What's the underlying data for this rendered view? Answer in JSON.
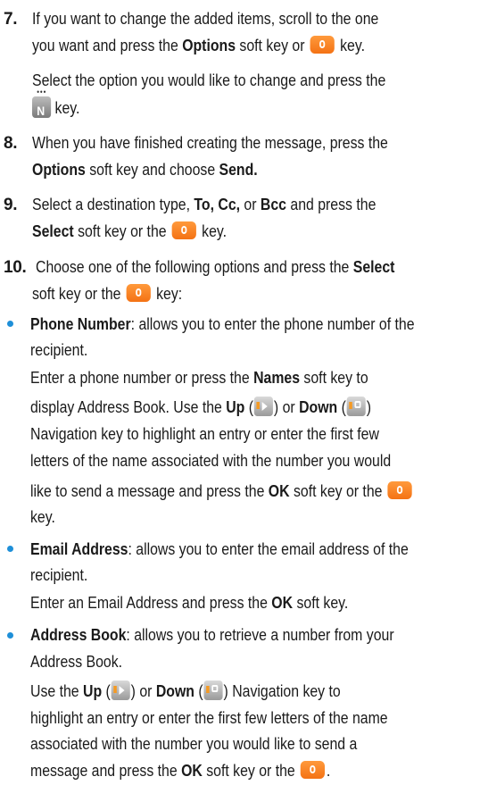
{
  "steps": {
    "s7": {
      "num": "7.",
      "l1": "If you want to change the added items, scroll to the one",
      "l2a": "you want and press the ",
      "l2b": "Options",
      "l2c": " soft key or ",
      "l2d": " key.",
      "l3": "Select the option you would like to change and press the",
      "l4": " key."
    },
    "s8": {
      "num": "8.",
      "l1": "When you have finished creating the message, press the",
      "l2a": "Options",
      "l2b": " soft key and choose ",
      "l2c": "Send."
    },
    "s9": {
      "num": "9.",
      "l1a": "Select a destination type, ",
      "l1b": "To, Cc,",
      "l1c": " or ",
      "l1d": "Bcc",
      "l1e": " and press the",
      "l2a": "Select",
      "l2b": " soft key or the ",
      "l2c": " key."
    },
    "s10": {
      "num": "10.",
      "l1a": "Choose one of the following options and press the ",
      "l1b": "Select",
      "l2a": "soft key or the ",
      "l2b": " key:"
    }
  },
  "bullets": {
    "phone": {
      "title": "Phone Number",
      "l1": ": allows you to enter the phone number of the",
      "l2": "recipient.",
      "l3a": "Enter a phone number or press the ",
      "l3b": "Names",
      "l3c": " soft key to",
      "l4a": "display Address Book. Use the ",
      "l4b": "Up",
      "l4c": " (",
      "l4d": ") or ",
      "l4e": "Down",
      "l4f": " (",
      "l4g": ")",
      "l5": "Navigation key to highlight an entry or enter the first few",
      "l6": "letters of the name associated with the number you would",
      "l7a": "like to send a message and press the ",
      "l7b": "OK",
      "l7c": " soft key or the ",
      "l8": "key."
    },
    "email": {
      "title": "Email Address",
      "l1": ": allows you to enter the email address of the",
      "l2": "recipient.",
      "l3a": "Enter an Email Address and press the ",
      "l3b": "OK",
      "l3c": " soft key."
    },
    "book": {
      "title": "Address Book",
      "l1": ": allows you to retrieve a number from your",
      "l2": "Address Book.",
      "l3a": "Use the ",
      "l3b": "Up",
      "l3c": " (",
      "l3d": ") or ",
      "l3e": "Down",
      "l3f": " (",
      "l3g": ") Navigation key to",
      "l4": "highlight an entry or enter the first few letters of the name",
      "l5": "associated with the number you would like to send a",
      "l6a": "message and press the ",
      "l6b": "OK",
      "l6c": " soft key or the ",
      "l6d": "."
    }
  }
}
